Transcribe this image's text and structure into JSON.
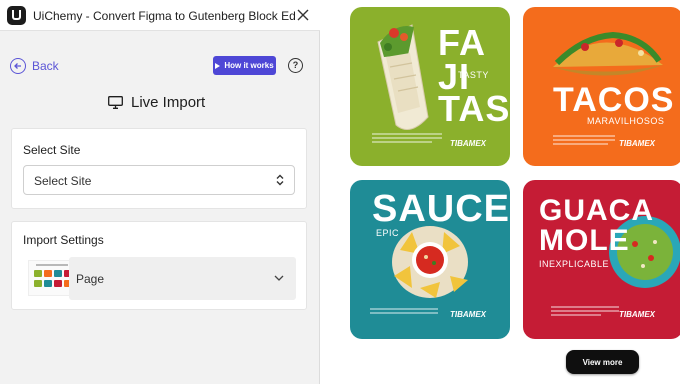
{
  "window": {
    "title": "UiChemy - Convert Figma to Gutenberg Block Editor...",
    "close_icon": "close-icon",
    "logo_icon": "uichemy-logo"
  },
  "nav": {
    "back_label": "Back",
    "how_it_works_label": "How it works",
    "help_icon": "question-mark-icon"
  },
  "page": {
    "heading": "Live Import",
    "heading_icon": "monitor-icon"
  },
  "select_site": {
    "title": "Select Site",
    "value": "Select Site"
  },
  "import_settings": {
    "title": "Import Settings",
    "value": "Page"
  },
  "gallery": {
    "fajitas": {
      "line1": "FA",
      "line2": "JI",
      "line3": "TAS",
      "tag": "TASTY",
      "brand": "TIBAMEX",
      "color": "#8bb02c"
    },
    "tacos": {
      "title": "TACOS",
      "tag": "MARAVILHOSOS",
      "brand": "TIBAMEX",
      "color": "#f46c1c"
    },
    "sauce": {
      "title": "SAUCE",
      "tag": "EPIC",
      "brand": "TIBAMEX",
      "color": "#1f8c96"
    },
    "guaca": {
      "line1": "GUACA",
      "line2": "MOLE",
      "tag": "INEXPLICABLE",
      "brand": "TIBAMEX",
      "color": "#c51c35"
    },
    "view_more_label": "View more"
  },
  "colors": {
    "accent": "#4e47d6",
    "link": "#5b55d6"
  }
}
